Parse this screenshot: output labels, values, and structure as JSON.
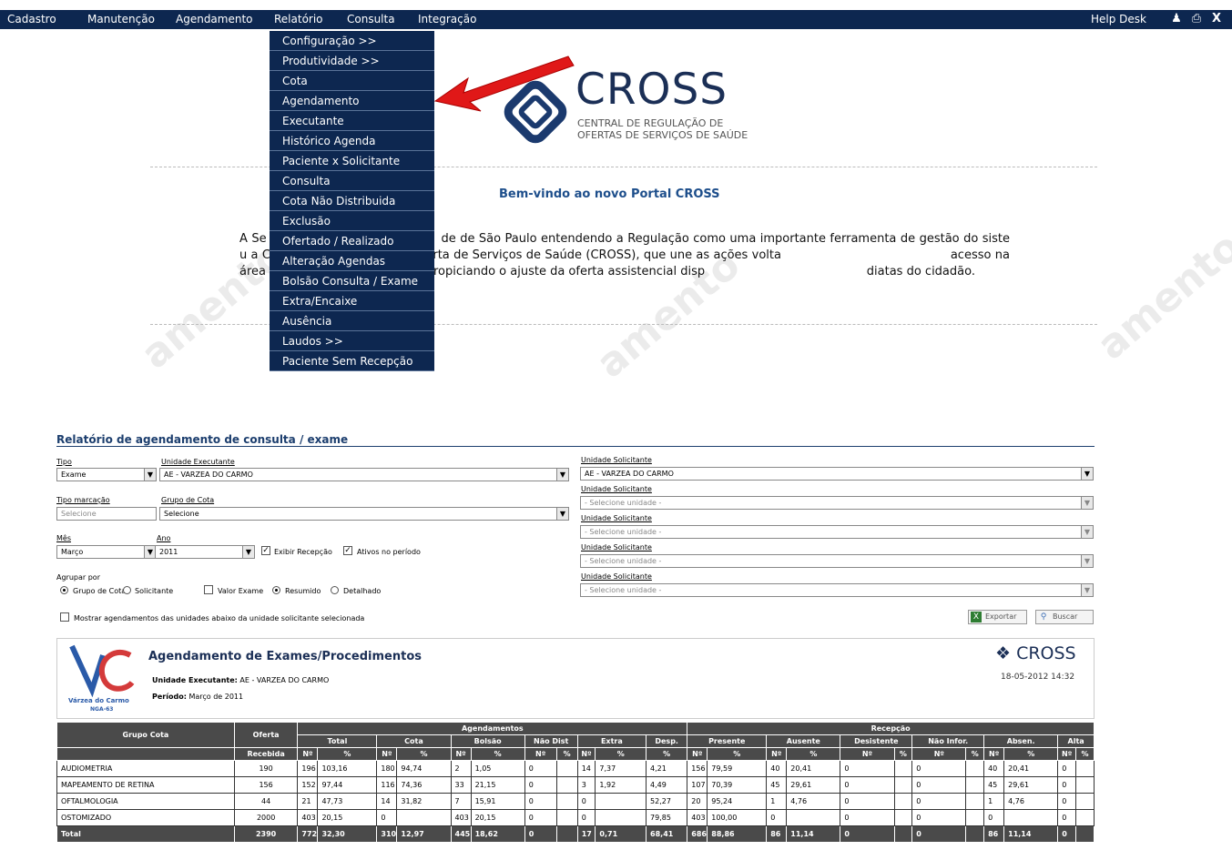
{
  "nav": {
    "items": [
      "Cadastro",
      "Manutenção",
      "Agendamento",
      "Relatório",
      "Consulta",
      "Integração"
    ],
    "help": "Help Desk"
  },
  "dropdown": {
    "items": [
      "Configuração  >>",
      "Produtividade  >>",
      "Cota",
      "Agendamento",
      "Executante",
      "Histórico Agenda",
      "Paciente x Solicitante",
      "Consulta",
      "Cota Não Distribuida",
      "Exclusão",
      "Ofertado / Realizado",
      "Alteração Agendas",
      "Bolsão Consulta / Exame",
      "Extra/Encaixe",
      "Ausência",
      "Laudos  >>",
      "Paciente Sem Recepção"
    ]
  },
  "logo": {
    "big": "CROSS",
    "sub1": "CENTRAL DE REGULAÇÃO DE",
    "sub2": "OFERTAS DE SERVIÇOS DE SAÚDE"
  },
  "welcome": "Bem-vindo ao novo Portal CROSS",
  "intro": "A Se                                           de de São Paulo entendendo a Regulação como uma importante ferramenta de gestão do siste                                           u a Central de Regulação de Oferta de Serviços de Saúde (CROSS), que une as ações volta                                           acesso na área hospitalar e ambulatorial, propiciando o ajuste da oferta assistencial disp                                           diatas do cidadão.",
  "watermark": "amento",
  "report": {
    "title": "Relatório de agendamento de consulta / exame",
    "labels": {
      "tipo": "Tipo",
      "unidade_exec": "Unidade Executante",
      "tipo_marcacao": "Tipo marcação",
      "grupo_cota": "Grupo de Cota",
      "mes": "Mês",
      "ano": "Ano",
      "agrupar": "Agrupar por",
      "unidade_sol": "Unidade Solicitante"
    },
    "values": {
      "tipo": "Exame",
      "unidade_exec": "AE - VARZEA DO CARMO",
      "tipo_marcacao": "Selecione",
      "grupo_cota": "Selecione",
      "mes": "Março",
      "ano": "2011",
      "unidade_sol1": "AE - VARZEA DO CARMO",
      "unidade_sol_ph": "- Selecione unidade -"
    },
    "checks": {
      "exibir_recepcao": "Exibir Recepção",
      "ativos": "Ativos no período",
      "valor_exame": "Valor Exame",
      "mostrar": "Mostrar agendamentos das unidades abaixo da unidade solicitante selecionada"
    },
    "radios": {
      "grupo_cota": "Grupo de Cota",
      "solicitante": "Solicitante",
      "resumido": "Resumido",
      "detalhado": "Detalhado"
    },
    "buttons": {
      "exportar": "Exportar",
      "buscar": "Buscar"
    },
    "header": {
      "h1": "Agendamento de Exames/Procedimentos",
      "unidade_label": "Unidade Executante:",
      "unidade_val": "AE - VARZEA DO CARMO",
      "periodo_label": "Período:",
      "periodo_val": "Março de 2011",
      "cross": "CROSS",
      "date": "18-05-2012 14:32",
      "vc_name": "Várzea do Carmo",
      "vc_code": "NGA-63"
    }
  },
  "table": {
    "col_grupo": "Grupo Cota",
    "col_oferta": "Oferta",
    "col_recebida": "Recebida",
    "grp_agend": "Agendamentos",
    "grp_recep": "Recepção",
    "sub": [
      "Total",
      "Cota",
      "Bolsão",
      "Não Dist",
      "Extra",
      "Desp.",
      "Presente",
      "Ausente",
      "Desistente",
      "Não Infor.",
      "Absen.",
      "Alta"
    ],
    "n": "Nº",
    "pct": "%",
    "rows": [
      [
        "AUDIOMETRIA",
        "190",
        "196",
        "103,16",
        "180",
        "94,74",
        "2",
        "1,05",
        "0",
        "",
        "14",
        "7,37",
        "4,21",
        "156",
        "79,59",
        "40",
        "20,41",
        "0",
        "",
        "0",
        "",
        "40",
        "20,41",
        "0",
        ""
      ],
      [
        "MAPEAMENTO DE RETINA",
        "156",
        "152",
        "97,44",
        "116",
        "74,36",
        "33",
        "21,15",
        "0",
        "",
        "3",
        "1,92",
        "4,49",
        "107",
        "70,39",
        "45",
        "29,61",
        "0",
        "",
        "0",
        "",
        "45",
        "29,61",
        "0",
        ""
      ],
      [
        "OFTALMOLOGIA",
        "44",
        "21",
        "47,73",
        "14",
        "31,82",
        "7",
        "15,91",
        "0",
        "",
        "0",
        "",
        "52,27",
        "20",
        "95,24",
        "1",
        "4,76",
        "0",
        "",
        "0",
        "",
        "1",
        "4,76",
        "0",
        ""
      ],
      [
        "OSTOMIZADO",
        "2000",
        "403",
        "20,15",
        "0",
        "",
        "403",
        "20,15",
        "0",
        "",
        "0",
        "",
        "79,85",
        "403",
        "100,00",
        "0",
        "",
        "0",
        "",
        "0",
        "",
        "0",
        "",
        "0",
        ""
      ]
    ],
    "total": [
      "Total",
      "2390",
      "772",
      "32,30",
      "310",
      "12,97",
      "445",
      "18,62",
      "0",
      "",
      "17",
      "0,71",
      "68,41",
      "686",
      "88,86",
      "86",
      "11,14",
      "0",
      "",
      "0",
      "",
      "86",
      "11,14",
      "0",
      ""
    ]
  }
}
